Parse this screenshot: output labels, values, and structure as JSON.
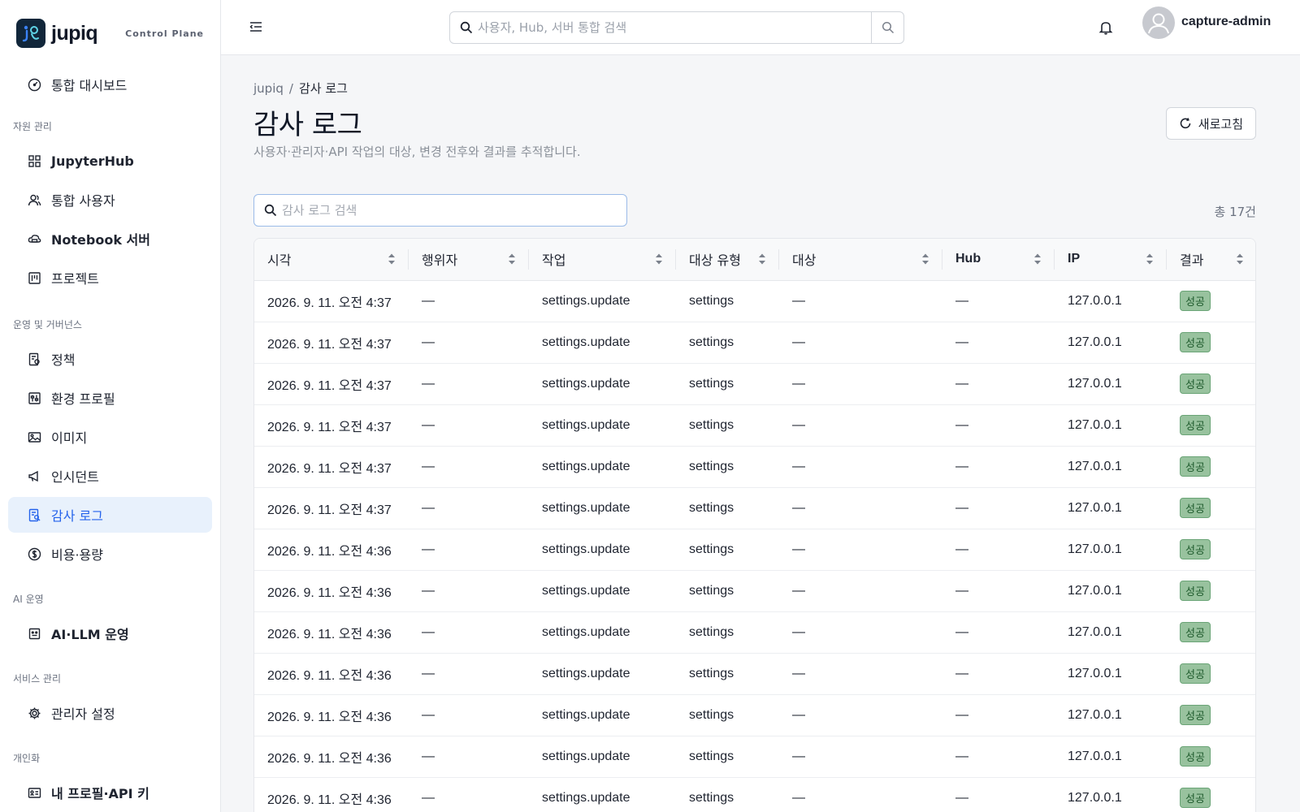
{
  "brand": {
    "name": "jupiq",
    "tagline": "Control Plane"
  },
  "sidebar": {
    "dashboard": {
      "label": "통합 대시보드",
      "icon": "dashboard-icon"
    },
    "sections": [
      {
        "title": "자원 관리",
        "items": [
          {
            "label": "JupyterHub",
            "icon": "grid-icon",
            "bold": true
          },
          {
            "label": "통합 사용자",
            "icon": "users-icon"
          },
          {
            "label": "Notebook 서버",
            "icon": "cloud-server-icon"
          },
          {
            "label": "프로젝트",
            "icon": "project-board-icon"
          }
        ]
      },
      {
        "title": "운영 및 거버넌스",
        "items": [
          {
            "label": "정책",
            "icon": "policy-icon"
          },
          {
            "label": "환경 프로필",
            "icon": "sliders-icon"
          },
          {
            "label": "이미지",
            "icon": "image-icon"
          },
          {
            "label": "인시던트",
            "icon": "megaphone-icon"
          },
          {
            "label": "감사 로그",
            "icon": "audit-log-icon",
            "active": true
          },
          {
            "label": "비용·용량",
            "icon": "dollar-icon"
          }
        ]
      },
      {
        "title": "AI 운영",
        "items": [
          {
            "label": "AI·LLM 운영",
            "icon": "robot-icon",
            "bold": true
          }
        ]
      },
      {
        "title": "서비스 관리",
        "items": [
          {
            "label": "관리자 설정",
            "icon": "gear-icon"
          }
        ]
      },
      {
        "title": "개인화",
        "items": [
          {
            "label": "내 프로필·API 키",
            "icon": "id-card-icon",
            "bold": true
          }
        ]
      }
    ]
  },
  "topbar": {
    "search_placeholder": "사용자, Hub, 서버 통합 검색",
    "user_name": "capture-admin"
  },
  "breadcrumb": {
    "root": "jupiq",
    "current": "감사 로그"
  },
  "page": {
    "title": "감사 로그",
    "subtitle": "사용자·관리자·API 작업의 대상, 변경 전후와 결과를 추적합니다.",
    "refresh_label": "새로고침",
    "search_placeholder": "감사 로그 검색",
    "total": "총 17건"
  },
  "table": {
    "columns": [
      "시각",
      "행위자",
      "작업",
      "대상 유형",
      "대상",
      "Hub",
      "IP",
      "결과"
    ],
    "rows": [
      [
        "2026. 9. 11. 오전 4:37",
        "—",
        "settings.update",
        "settings",
        "—",
        "—",
        "127.0.0.1",
        "성공"
      ],
      [
        "2026. 9. 11. 오전 4:37",
        "—",
        "settings.update",
        "settings",
        "—",
        "—",
        "127.0.0.1",
        "성공"
      ],
      [
        "2026. 9. 11. 오전 4:37",
        "—",
        "settings.update",
        "settings",
        "—",
        "—",
        "127.0.0.1",
        "성공"
      ],
      [
        "2026. 9. 11. 오전 4:37",
        "—",
        "settings.update",
        "settings",
        "—",
        "—",
        "127.0.0.1",
        "성공"
      ],
      [
        "2026. 9. 11. 오전 4:37",
        "—",
        "settings.update",
        "settings",
        "—",
        "—",
        "127.0.0.1",
        "성공"
      ],
      [
        "2026. 9. 11. 오전 4:37",
        "—",
        "settings.update",
        "settings",
        "—",
        "—",
        "127.0.0.1",
        "성공"
      ],
      [
        "2026. 9. 11. 오전 4:36",
        "—",
        "settings.update",
        "settings",
        "—",
        "—",
        "127.0.0.1",
        "성공"
      ],
      [
        "2026. 9. 11. 오전 4:36",
        "—",
        "settings.update",
        "settings",
        "—",
        "—",
        "127.0.0.1",
        "성공"
      ],
      [
        "2026. 9. 11. 오전 4:36",
        "—",
        "settings.update",
        "settings",
        "—",
        "—",
        "127.0.0.1",
        "성공"
      ],
      [
        "2026. 9. 11. 오전 4:36",
        "—",
        "settings.update",
        "settings",
        "—",
        "—",
        "127.0.0.1",
        "성공"
      ],
      [
        "2026. 9. 11. 오전 4:36",
        "—",
        "settings.update",
        "settings",
        "—",
        "—",
        "127.0.0.1",
        "성공"
      ],
      [
        "2026. 9. 11. 오전 4:36",
        "—",
        "settings.update",
        "settings",
        "—",
        "—",
        "127.0.0.1",
        "성공"
      ],
      [
        "2026. 9. 11. 오전 4:36",
        "—",
        "settings.update",
        "settings",
        "—",
        "—",
        "127.0.0.1",
        "성공"
      ]
    ]
  },
  "colors": {
    "accent": "#2563eb",
    "active_bg": "#e8f1fc",
    "success_bg": "#98c29e",
    "success_text": "#1e5a2c"
  }
}
